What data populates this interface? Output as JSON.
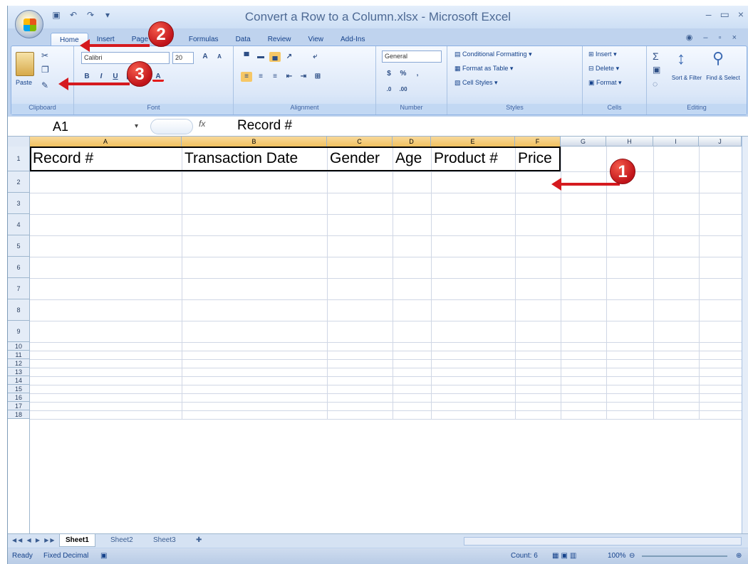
{
  "window": {
    "title": "Convert a Row to a Column.xlsx - Microsoft Excel",
    "controls": [
      "–",
      "▭",
      "×"
    ]
  },
  "ribbon_tabs": [
    "Home",
    "Insert",
    "Page Layout",
    "Formulas",
    "Data",
    "Review",
    "View",
    "Add-Ins"
  ],
  "ribbon": {
    "clipboard": {
      "label": "Clipboard",
      "paste": "Paste"
    },
    "font": {
      "label": "Font",
      "name": "Calibri",
      "size": "20"
    },
    "alignment": {
      "label": "Alignment"
    },
    "number": {
      "label": "Number",
      "format": "General"
    },
    "styles": {
      "label": "Styles",
      "conditional": "Conditional Formatting",
      "table": "Format as Table",
      "cellstyles": "Cell Styles"
    },
    "cells": {
      "label": "Cells",
      "insert": "Insert",
      "delete": "Delete",
      "format": "Format"
    },
    "editing": {
      "label": "Editing",
      "sort": "Sort & Filter",
      "find": "Find & Select"
    }
  },
  "formula_bar": {
    "name_box": "A1",
    "fx": "fx",
    "content": "Record #"
  },
  "columns": [
    "A",
    "B",
    "C",
    "D",
    "E",
    "F",
    "G",
    "H",
    "I",
    "J"
  ],
  "rows": [
    "1",
    "2",
    "3",
    "4",
    "5",
    "6",
    "7",
    "8",
    "9",
    "10",
    "11",
    "12",
    "13",
    "14",
    "15",
    "16",
    "17",
    "18"
  ],
  "row1": [
    "Record #",
    "Transaction Date",
    "Gender",
    "Age",
    "Product #",
    "Price"
  ],
  "sheets": [
    "Sheet1",
    "Sheet2",
    "Sheet3"
  ],
  "status": {
    "ready": "Ready",
    "mode": "Fixed Decimal",
    "count": "Count: 6",
    "zoom": "100%"
  },
  "callouts": [
    "1",
    "2",
    "3"
  ],
  "colors": {
    "callout": "#c1141a",
    "ribbon": "#dbe7f8",
    "selected_header": "#f1c15f"
  }
}
